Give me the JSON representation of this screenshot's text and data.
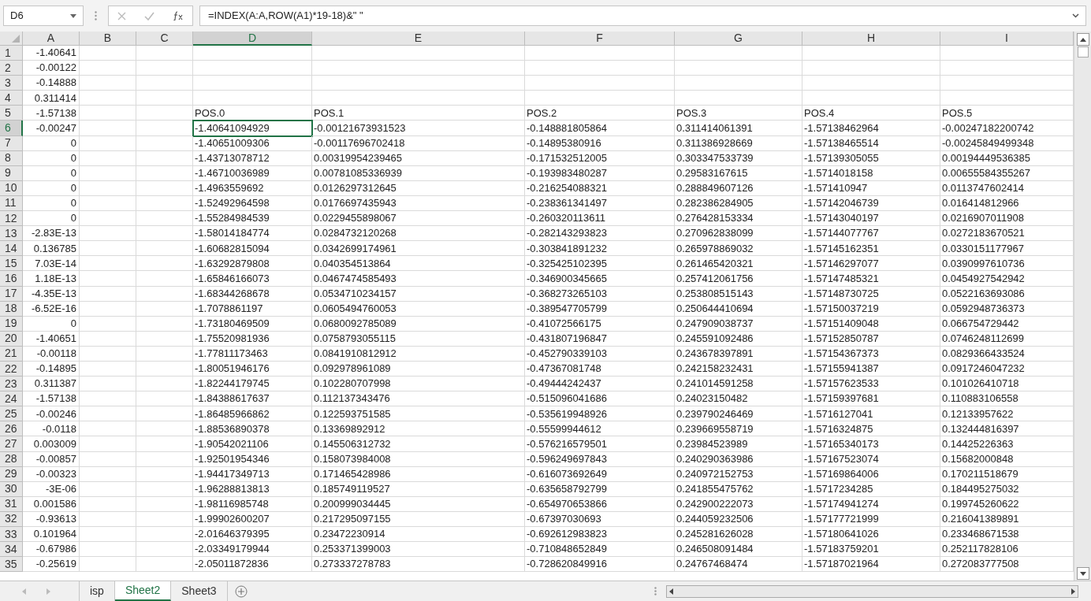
{
  "name_box": "D6",
  "formula": "=INDEX(A:A,ROW(A1)*19-18)&\" \"",
  "columns": [
    {
      "label": "A",
      "kind": "number",
      "selected": false
    },
    {
      "label": "B",
      "kind": "number",
      "selected": false
    },
    {
      "label": "C",
      "kind": "number",
      "selected": false
    },
    {
      "label": "D",
      "kind": "text",
      "selected": true
    },
    {
      "label": "E",
      "kind": "text",
      "selected": false
    },
    {
      "label": "F",
      "kind": "text",
      "selected": false
    },
    {
      "label": "G",
      "kind": "text",
      "selected": false
    },
    {
      "label": "H",
      "kind": "text",
      "selected": false
    },
    {
      "label": "I",
      "kind": "text",
      "selected": false
    }
  ],
  "rows": [
    {
      "header": "1",
      "selected": false,
      "cells": {
        "A": "-1.40641"
      }
    },
    {
      "header": "2",
      "selected": false,
      "cells": {
        "A": "-0.00122"
      }
    },
    {
      "header": "3",
      "selected": false,
      "cells": {
        "A": "-0.14888"
      }
    },
    {
      "header": "4",
      "selected": false,
      "cells": {
        "A": "0.311414"
      }
    },
    {
      "header": "5",
      "selected": false,
      "cells": {
        "A": "-1.57138",
        "D": "POS.0",
        "E": "POS.1",
        "F": "POS.2",
        "G": "POS.3",
        "H": "POS.4",
        "I": "POS.5"
      }
    },
    {
      "header": "6",
      "selected": true,
      "cells": {
        "A": "-0.00247",
        "D": "-1.40641094929",
        "E": "-0.00121673931523",
        "F": "-0.148881805864",
        "G": "0.311414061391",
        "H": "-1.57138462964",
        "I": "-0.00247182200742"
      }
    },
    {
      "header": "7",
      "selected": false,
      "cells": {
        "A": "0",
        "D": "-1.40651009306",
        "E": "-0.00117696702418",
        "F": "-0.14895380916",
        "G": "0.311386928669",
        "H": "-1.57138465514",
        "I": "-0.00245849499348"
      }
    },
    {
      "header": "8",
      "selected": false,
      "cells": {
        "A": "0",
        "D": "-1.43713078712",
        "E": "0.00319954239465",
        "F": "-0.171532512005",
        "G": "0.303347533739",
        "H": "-1.57139305055",
        "I": "0.00194449536385"
      }
    },
    {
      "header": "9",
      "selected": false,
      "cells": {
        "A": "0",
        "D": "-1.46710036989",
        "E": "0.00781085336939",
        "F": "-0.193983480287",
        "G": "0.29583167615",
        "H": "-1.5714018158",
        "I": "0.00655584355267"
      }
    },
    {
      "header": "10",
      "selected": false,
      "cells": {
        "A": "0",
        "D": "-1.4963559692",
        "E": "0.0126297312645",
        "F": "-0.216254088321",
        "G": "0.288849607126",
        "H": "-1.571410947",
        "I": "0.0113747602414"
      }
    },
    {
      "header": "11",
      "selected": false,
      "cells": {
        "A": "0",
        "D": "-1.52492964598",
        "E": "0.0176697435943",
        "F": "-0.238361341497",
        "G": "0.282386284905",
        "H": "-1.57142046739",
        "I": "0.016414812966"
      }
    },
    {
      "header": "12",
      "selected": false,
      "cells": {
        "A": "0",
        "D": "-1.55284984539",
        "E": "0.0229455898067",
        "F": "-0.260320113611",
        "G": "0.276428153334",
        "H": "-1.57143040197",
        "I": "0.0216907011908"
      }
    },
    {
      "header": "13",
      "selected": false,
      "cells": {
        "A": "-2.83E-13",
        "D": "-1.58014184774",
        "E": "0.0284732120268",
        "F": "-0.282143293823",
        "G": "0.270962838099",
        "H": "-1.57144077767",
        "I": "0.0272183670521"
      }
    },
    {
      "header": "14",
      "selected": false,
      "cells": {
        "A": "0.136785",
        "D": "-1.60682815094",
        "E": "0.0342699174961",
        "F": "-0.303841891232",
        "G": "0.265978869032",
        "H": "-1.57145162351",
        "I": "0.0330151177967"
      }
    },
    {
      "header": "15",
      "selected": false,
      "cells": {
        "A": "7.03E-14",
        "D": "-1.63292879808",
        "E": "0.040354513864",
        "F": "-0.325425102395",
        "G": "0.261465420321",
        "H": "-1.57146297077",
        "I": "0.0390997610736"
      }
    },
    {
      "header": "16",
      "selected": false,
      "cells": {
        "A": "1.18E-13",
        "D": "-1.65846166073",
        "E": "0.0467474585493",
        "F": "-0.346900345665",
        "G": "0.257412061756",
        "H": "-1.57147485321",
        "I": "0.0454927542942"
      }
    },
    {
      "header": "17",
      "selected": false,
      "cells": {
        "A": "-4.35E-13",
        "D": "-1.68344268678",
        "E": "0.0534710234157",
        "F": "-0.368273265103",
        "G": "0.253808515143",
        "H": "-1.57148730725",
        "I": "0.0522163693086"
      }
    },
    {
      "header": "18",
      "selected": false,
      "cells": {
        "A": "-6.52E-16",
        "D": "-1.7078861197",
        "E": "0.0605494760053",
        "F": "-0.389547705799",
        "G": "0.250644410694",
        "H": "-1.57150037219",
        "I": "0.0592948736373"
      }
    },
    {
      "header": "19",
      "selected": false,
      "cells": {
        "A": "0",
        "D": "-1.73180469509",
        "E": "0.0680092785089",
        "F": "-0.41072566175",
        "G": "0.247909038737",
        "H": "-1.57151409048",
        "I": "0.066754729442"
      }
    },
    {
      "header": "20",
      "selected": false,
      "cells": {
        "A": "-1.40651",
        "D": "-1.75520981936",
        "E": "0.0758793055115",
        "F": "-0.431807196847",
        "G": "0.245591092486",
        "H": "-1.57152850787",
        "I": "0.0746248112699"
      }
    },
    {
      "header": "21",
      "selected": false,
      "cells": {
        "A": "-0.00118",
        "D": "-1.77811173463",
        "E": "0.0841910812912",
        "F": "-0.452790339103",
        "G": "0.243678397891",
        "H": "-1.57154367373",
        "I": "0.0829366433524"
      }
    },
    {
      "header": "22",
      "selected": false,
      "cells": {
        "A": "-0.14895",
        "D": "-1.80051946176",
        "E": "0.092978961089",
        "F": "-0.47367081748",
        "G": "0.242158232431",
        "H": "-1.57155941387",
        "I": "0.0917246047232"
      }
    },
    {
      "header": "23",
      "selected": false,
      "cells": {
        "A": "0.311387",
        "D": "-1.82244179745",
        "E": "0.102280707998",
        "F": "-0.49444242437",
        "G": "0.241014591258",
        "H": "-1.57157623533",
        "I": "0.101026410718"
      }
    },
    {
      "header": "24",
      "selected": false,
      "cells": {
        "A": "-1.57138",
        "D": "-1.84388617637",
        "E": "0.112137343476",
        "F": "-0.515096041686",
        "G": "0.24023150482",
        "H": "-1.57159397681",
        "I": "0.110883106558"
      }
    },
    {
      "header": "25",
      "selected": false,
      "cells": {
        "A": "-0.00246",
        "D": "-1.86485966862",
        "E": "0.122593751585",
        "F": "-0.535619948926",
        "G": "0.239790246469",
        "H": "-1.5716127041",
        "I": "0.12133957622"
      }
    },
    {
      "header": "26",
      "selected": false,
      "cells": {
        "A": "-0.0118",
        "D": "-1.88536890378",
        "E": "0.13369892912",
        "F": "-0.55599944612",
        "G": "0.239669558719",
        "H": "-1.5716324875",
        "I": "0.132444816397"
      }
    },
    {
      "header": "27",
      "selected": false,
      "cells": {
        "A": "0.003009",
        "D": "-1.90542021106",
        "E": "0.145506312732",
        "F": "-0.576216579501",
        "G": "0.23984523989",
        "H": "-1.57165340173",
        "I": "0.14425226363"
      }
    },
    {
      "header": "28",
      "selected": false,
      "cells": {
        "A": "-0.00857",
        "D": "-1.92501954346",
        "E": "0.158073984008",
        "F": "-0.596249697843",
        "G": "0.240290363986",
        "H": "-1.57167523074",
        "I": "0.15682000848"
      }
    },
    {
      "header": "29",
      "selected": false,
      "cells": {
        "A": "-0.00323",
        "D": "-1.94417349713",
        "E": "0.171465428986",
        "F": "-0.616073692649",
        "G": "0.240972152753",
        "H": "-1.57169864006",
        "I": "0.170211518679"
      }
    },
    {
      "header": "30",
      "selected": false,
      "cells": {
        "A": "-3E-06",
        "D": "-1.96288813813",
        "E": "0.185749119527",
        "F": "-0.635658792799",
        "G": "0.241855475762",
        "H": "-1.5717234285",
        "I": "0.184495275032"
      }
    },
    {
      "header": "31",
      "selected": false,
      "cells": {
        "A": "0.001586",
        "D": "-1.98116985748",
        "E": "0.200999034445",
        "F": "-0.654970653866",
        "G": "0.242900222073",
        "H": "-1.57174941274",
        "I": "0.199745260622"
      }
    },
    {
      "header": "32",
      "selected": false,
      "cells": {
        "A": "-0.93613",
        "D": "-1.99902600207",
        "E": "0.217295097155",
        "F": "-0.67397030693",
        "G": "0.244059232506",
        "H": "-1.57177721999",
        "I": "0.216041389891"
      }
    },
    {
      "header": "33",
      "selected": false,
      "cells": {
        "A": "0.101964",
        "D": "-2.01646379395",
        "E": "0.23472230914",
        "F": "-0.692612983823",
        "G": "0.245281626028",
        "H": "-1.57180641026",
        "I": "0.233468671538"
      }
    },
    {
      "header": "34",
      "selected": false,
      "cells": {
        "A": "-0.67986",
        "D": "-2.03349179944",
        "E": "0.253371399003",
        "F": "-0.710848652849",
        "G": "0.246508091484",
        "H": "-1.57183759201",
        "I": "0.252117828106"
      }
    },
    {
      "header": "35",
      "selected": false,
      "cells": {
        "A": "-0.25619",
        "D": "-2.05011872836",
        "E": "0.273337278783",
        "F": "-0.728620849916",
        "G": "0.24767468474",
        "H": "-1.57187021964",
        "I": "0.272083777508"
      }
    }
  ],
  "sheet_tabs": [
    {
      "label": "isp",
      "selected": false
    },
    {
      "label": "Sheet2",
      "selected": true
    },
    {
      "label": "Sheet3",
      "selected": false
    }
  ]
}
